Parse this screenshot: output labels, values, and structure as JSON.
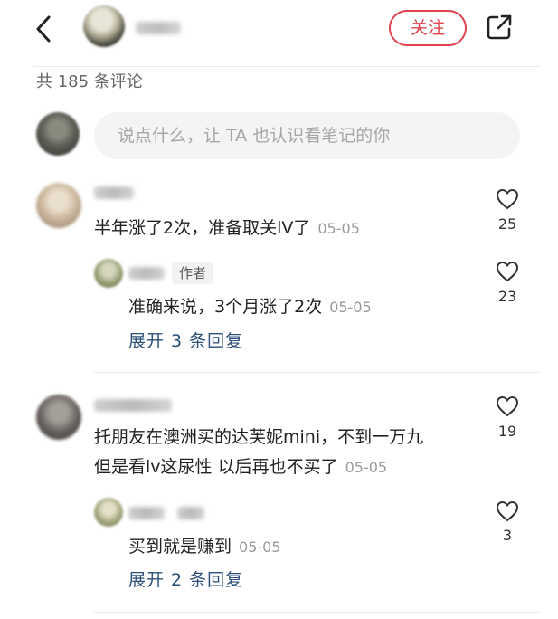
{
  "header": {
    "follow_label": "关注",
    "icons": [
      "back-icon",
      "share-icon"
    ]
  },
  "comments_header": {
    "count_text": "共 185 条评论"
  },
  "input": {
    "placeholder": "说点什么，让 TA 也认识看笔记的你"
  },
  "comments": [
    {
      "text": "半年涨了2次，准备取关lV了",
      "date": "05-05",
      "likes": "25",
      "replies": [
        {
          "author_tag": "作者",
          "text": "准确来说，3个月涨了2次",
          "date": "05-05",
          "likes": "23"
        }
      ],
      "expand_label": "展开 3 条回复"
    },
    {
      "text_line1": "托朋友在澳洲买的达芙妮mini，不到一万九",
      "text_line2": "但是看lv这尿性 以后再也不买了",
      "date": "05-05",
      "likes": "19",
      "replies": [
        {
          "text": "买到就是赚到",
          "date": "05-05",
          "likes": "3"
        }
      ],
      "expand_label": "展开 2 条回复"
    }
  ],
  "colors": {
    "accent": "#e0424f",
    "link": "#2d4f77",
    "muted": "#9a9a9a"
  }
}
